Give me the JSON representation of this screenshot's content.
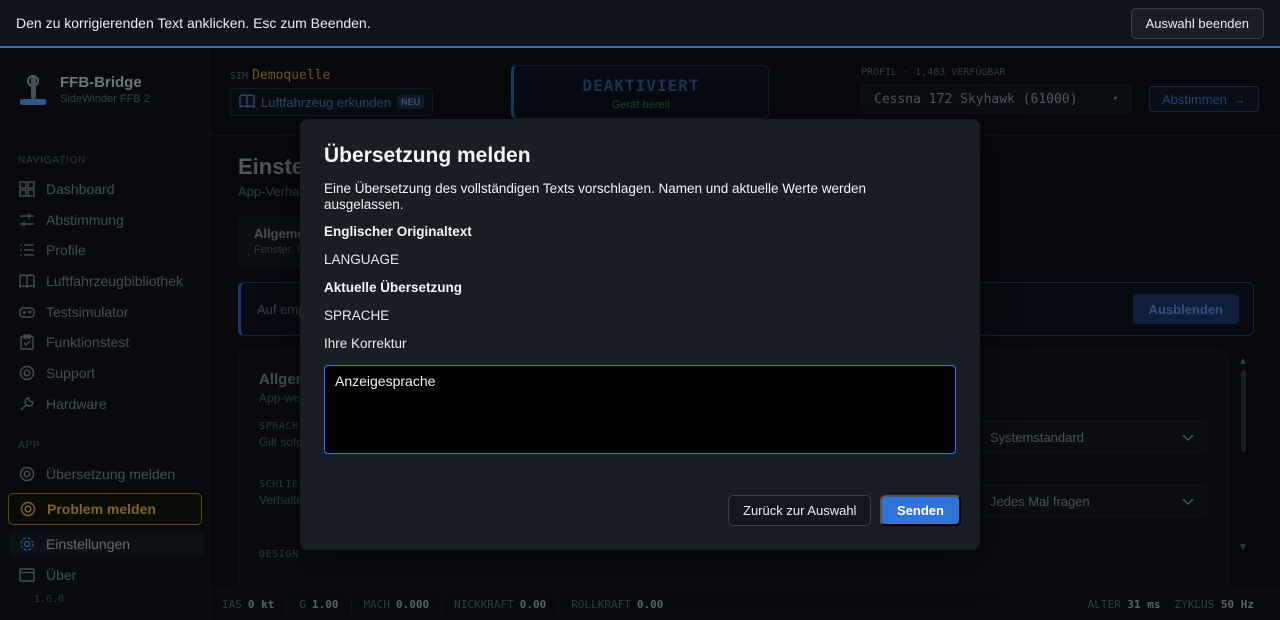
{
  "banner": {
    "instruction": "Den zu korrigierenden Text anklicken. Esc zum Beenden.",
    "end_button": "Auswahl beenden"
  },
  "brand": {
    "name": "FFB-Bridge",
    "subtitle": "SideWinder FFB 2"
  },
  "sim": {
    "label": "SIM",
    "value": "Demoquelle",
    "explore_label": "Luftfahrzeug erkunden",
    "explore_badge": "NEU"
  },
  "status": {
    "main": "DEAKTIVIERT",
    "sub": "Gerät bereit"
  },
  "profile": {
    "label": "PROFIL · 1,403 VERFÜGBAR",
    "selected": "Cessna 172 Skyhawk (61000)",
    "tune_button": "Abstimmen"
  },
  "sidebar": {
    "nav_heading": "NAVIGATION",
    "nav_items": [
      {
        "label": "Dashboard",
        "icon": "dashboard-icon"
      },
      {
        "label": "Abstimmung",
        "icon": "sliders-icon"
      },
      {
        "label": "Profile",
        "icon": "list-icon"
      },
      {
        "label": "Luftfahrzeugbibliothek",
        "icon": "book-icon"
      },
      {
        "label": "Testsimulator",
        "icon": "gamepad-icon"
      },
      {
        "label": "Funktionstest",
        "icon": "clipboard-icon"
      },
      {
        "label": "Support",
        "icon": "lifebuoy-icon"
      },
      {
        "label": "Hardware",
        "icon": "wrench-icon"
      }
    ],
    "app_heading": "APP",
    "app_items": [
      {
        "label": "Übersetzung melden",
        "icon": "lifebuoy-icon"
      },
      {
        "label": "Problem melden",
        "icon": "lifebuoy-icon"
      },
      {
        "label": "Einstellungen",
        "icon": "gear-icon"
      },
      {
        "label": "Über",
        "icon": "window-icon"
      }
    ],
    "version": "1.6.0"
  },
  "page": {
    "title": "Einste",
    "subtitle": "App-Verha",
    "tab_title": "Allgeme",
    "tab_sub": "Fenster, I",
    "notice_text": "Auf emp",
    "hide_button": "Ausblenden",
    "section_title": "Allgem",
    "section_sub": "App-we",
    "row1_label": "SPRACH",
    "row1_desc": "Gilt sofo",
    "row1_value": "Systemstandard",
    "row2_label": "SCHLIE",
    "row2_desc": "Verhalte",
    "row2_value": "Jedes Mal fragen",
    "row3_label": "DESIGN"
  },
  "footer": {
    "ias_label": "IAS",
    "ias_value": "0 kt",
    "g_label": "G",
    "g_value": "1.00",
    "mach_label": "MACH",
    "mach_value": "0.000",
    "pitch_label": "NICKKRAFT",
    "pitch_value": "0.00",
    "roll_label": "ROLLKRAFT",
    "roll_value": "0.00",
    "age_label": "ALTER",
    "age_value": "31 ms",
    "cycle_label": "ZYKLUS",
    "cycle_value": "50 Hz"
  },
  "modal": {
    "title": "Übersetzung melden",
    "description": "Eine Übersetzung des vollständigen Texts vorschlagen. Namen und aktuelle Werte werden ausgelassen.",
    "original_label": "Englischer Originaltext",
    "original_value": "LANGUAGE",
    "current_label": "Aktuelle Übersetzung",
    "current_value": "SPRACHE",
    "correction_label": "Ihre Korrektur",
    "correction_value": "Anzeigesprache",
    "back_button": "Zurück zur Auswahl",
    "send_button": "Senden"
  }
}
